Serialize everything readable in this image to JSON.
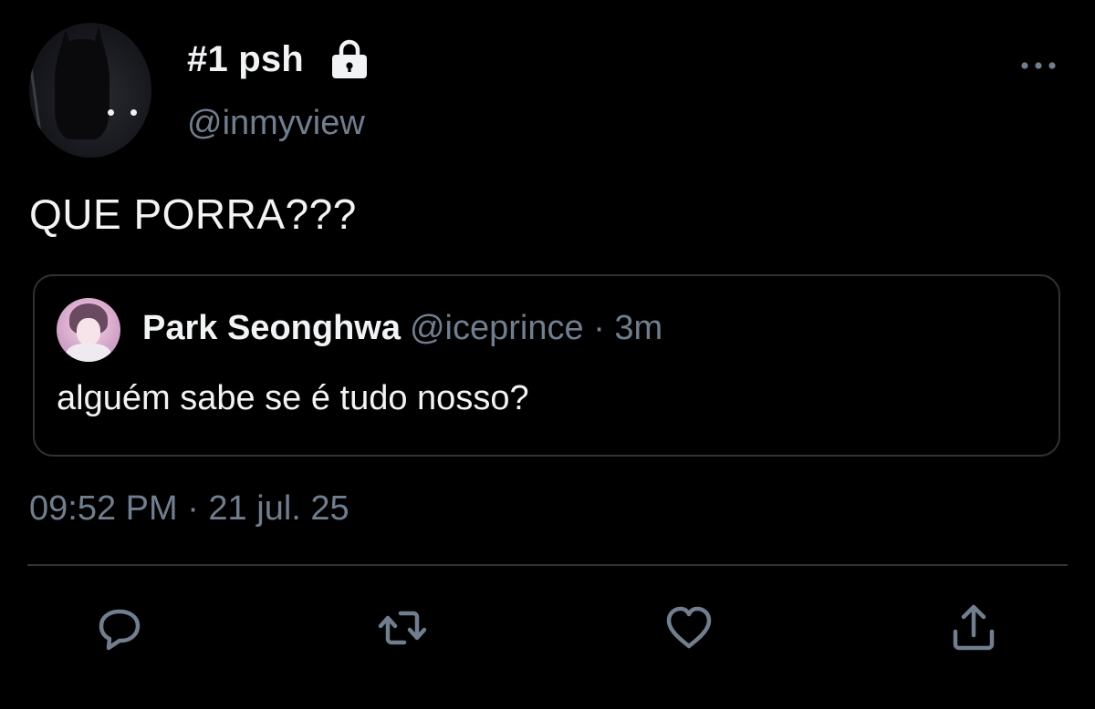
{
  "author": {
    "display_name": "#1 psh",
    "username": "@inmyview",
    "protected_icon": "lock-icon"
  },
  "tweet": {
    "text": "QUE PORRA???",
    "timestamp": "09:52 PM · 21 jul. 25"
  },
  "quoted": {
    "display_name": "Park Seonghwa",
    "meta": "@iceprince · 3m",
    "text": "alguém sabe se é tudo nosso?"
  },
  "actions": {
    "reply_icon": "reply-icon",
    "retweet_icon": "retweet-icon",
    "like_icon": "heart-icon",
    "share_icon": "share-icon",
    "more_icon": "more-icon"
  },
  "colors": {
    "background": "#000000",
    "text_primary": "#f2f3f5",
    "text_secondary": "#717e8d",
    "border": "#2f3336"
  }
}
